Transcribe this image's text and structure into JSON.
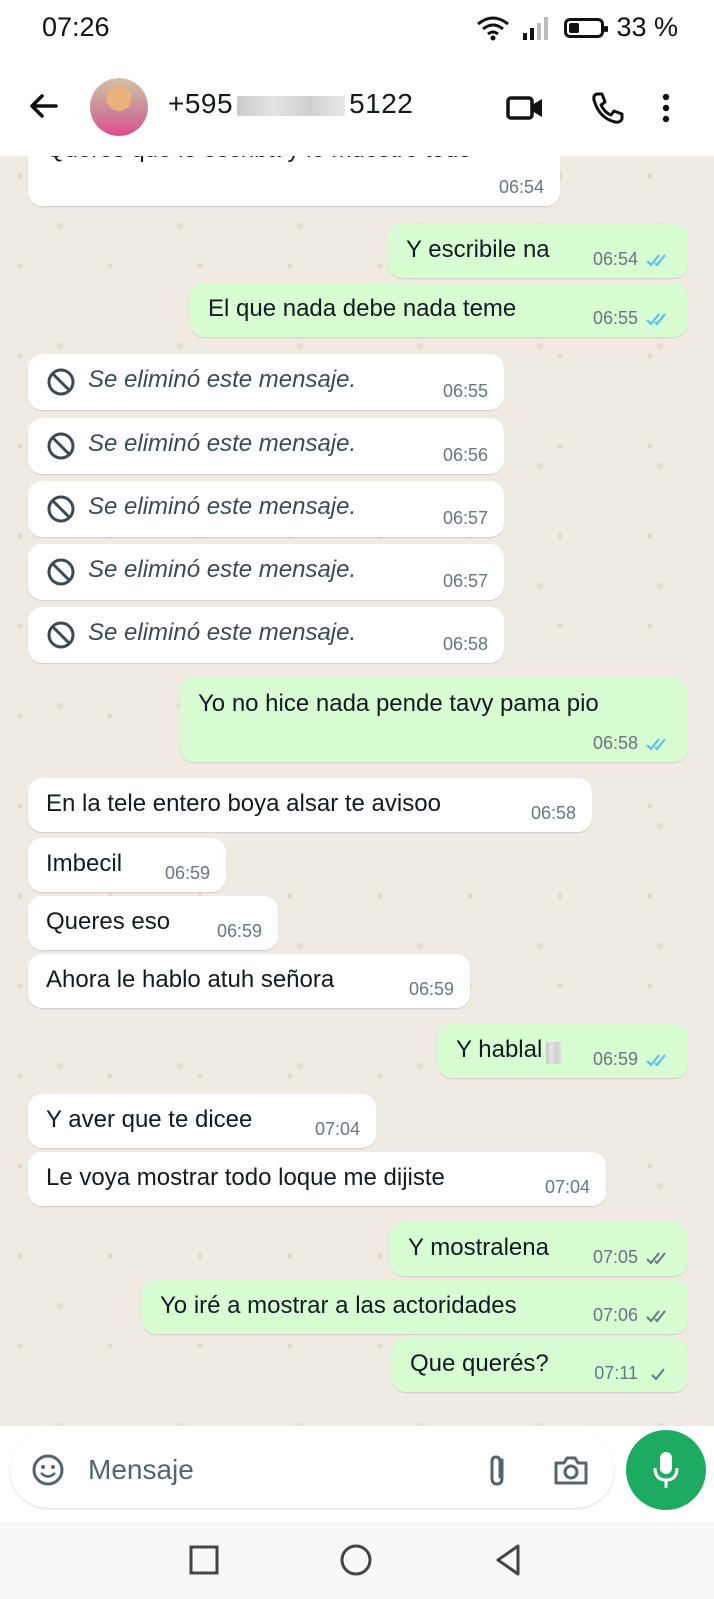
{
  "status": {
    "time": "07:26",
    "battery": "33 %"
  },
  "header": {
    "contact_prefix": "+595",
    "contact_suffix": "5122"
  },
  "messages": [
    {
      "text": "Queres que le escriba y le muestre todo",
      "time": "06:54"
    },
    {
      "text": "Y escribile na",
      "time": "06:54",
      "ticks": "read"
    },
    {
      "text": "El que nada debe nada teme",
      "time": "06:55",
      "ticks": "read"
    },
    {
      "text": "Se eliminó este mensaje.",
      "time": "06:55"
    },
    {
      "text": "Se eliminó este mensaje.",
      "time": "06:56"
    },
    {
      "text": "Se eliminó este mensaje.",
      "time": "06:57"
    },
    {
      "text": "Se eliminó este mensaje.",
      "time": "06:57"
    },
    {
      "text": "Se eliminó este mensaje.",
      "time": "06:58"
    },
    {
      "text": "Yo no hice nada pende tavy pama pio",
      "time": "06:58",
      "ticks": "read"
    },
    {
      "text": "En la tele entero boya alsar te avisoo",
      "time": "06:58"
    },
    {
      "text": "Imbecil",
      "time": "06:59"
    },
    {
      "text": "Queres eso",
      "time": "06:59"
    },
    {
      "text": "Ahora le hablo atuh señora",
      "time": "06:59"
    },
    {
      "text": "Y hablal",
      "time": "06:59",
      "ticks": "read"
    },
    {
      "text": "Y aver que te dicee",
      "time": "07:04"
    },
    {
      "text": "Le voya mostrar todo loque me dijiste",
      "time": "07:04"
    },
    {
      "text": "Y mostralena",
      "time": "07:05",
      "ticks": "delivered"
    },
    {
      "text": "Yo iré a mostrar a las actoridades",
      "time": "07:06",
      "ticks": "delivered"
    },
    {
      "text": "Que querés?",
      "time": "07:11",
      "ticks": "sent"
    }
  ],
  "composer": {
    "placeholder": "Mensaje"
  },
  "colors": {
    "read_tick": "#53bdeb",
    "grey_tick": "#667781",
    "outgoing": "#d9fdd3",
    "mic": "#1daa61"
  },
  "icons": [
    "back-arrow-icon",
    "video-call-icon",
    "phone-icon",
    "more-vert-icon",
    "block-icon",
    "emoji-icon",
    "attach-icon",
    "camera-icon",
    "mic-icon",
    "nav-recents-icon",
    "nav-home-icon",
    "nav-back-icon"
  ]
}
